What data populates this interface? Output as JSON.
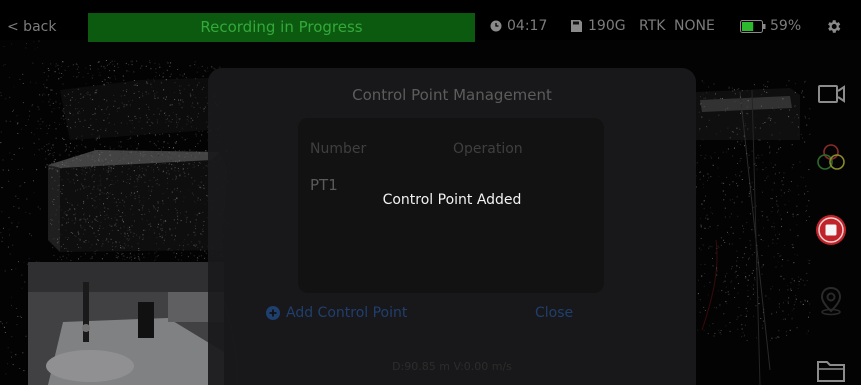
{
  "topbar": {
    "back_label": "< back",
    "recording_label": "Recording in Progress",
    "record_icon": "record-dot-icon",
    "elapsed_time": "04:17",
    "storage_icon": "sd-card-icon",
    "storage_free": "190G",
    "rtk_label": "RTK",
    "rtk_status": "NONE",
    "battery_icon": "battery-icon",
    "battery_percent": "59%",
    "battery_level": 0.59,
    "settings_icon": "gear-icon"
  },
  "toolbar": {
    "items": [
      {
        "icon": "video-camera-icon"
      },
      {
        "icon": "color-mode-icon"
      },
      {
        "icon": "stop-record-icon"
      },
      {
        "icon": "location-pin-icon"
      },
      {
        "icon": "folder-icon"
      }
    ]
  },
  "modal": {
    "title": "Control Point Management",
    "columns": [
      "Number",
      "Operation"
    ],
    "rows": [
      {
        "number": "PT1",
        "operation": ""
      }
    ],
    "toast": "Control Point Added",
    "add_label": "Add Control Point",
    "close_label": "Close",
    "footer_info": "D:90.85 m V:0.00 m/s"
  },
  "colors": {
    "recording_bg": "#0b5a10",
    "recording_text": "#35a83a",
    "accent_blue": "#1f3f6e",
    "stop_red": "#c0242a",
    "battery_green": "#2eb82e"
  }
}
